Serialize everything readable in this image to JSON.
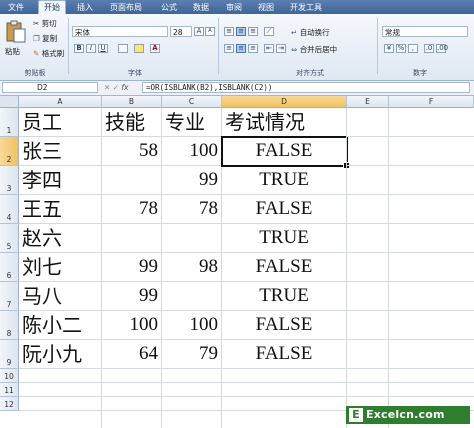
{
  "ribbon": {
    "tabs": [
      "文件",
      "开始",
      "插入",
      "页面布局",
      "公式",
      "数据",
      "审阅",
      "视图",
      "开发工具"
    ],
    "active_tab": "开始",
    "clipboard": {
      "paste": "粘贴",
      "cut": "剪切",
      "copy": "复制",
      "format_painter": "格式刷",
      "group": "剪贴板"
    },
    "font": {
      "name": "宋体",
      "size": "28",
      "bold": "B",
      "italic": "I",
      "underline": "U",
      "grow": "A",
      "shrink": "A",
      "color": "A",
      "group": "字体"
    },
    "alignment": {
      "wrap": "自动换行",
      "merge": "合并后居中",
      "group": "对齐方式"
    },
    "number": {
      "format": "常规",
      "group": "数字"
    }
  },
  "formula_bar": {
    "name_box": "D2",
    "fx": "fx",
    "formula": "=OR(ISBLANK(B2),ISBLANK(C2))"
  },
  "sheet": {
    "columns": [
      "A",
      "B",
      "C",
      "D",
      "E",
      "F"
    ],
    "rows": [
      "1",
      "2",
      "3",
      "4",
      "5",
      "6",
      "7",
      "8",
      "9",
      "10",
      "11",
      "12"
    ],
    "cells": [
      [
        "员工",
        "技能",
        "专业",
        "考试情况"
      ],
      [
        "张三",
        "58",
        "100",
        "FALSE"
      ],
      [
        "李四",
        "",
        "99",
        "TRUE"
      ],
      [
        "王五",
        "78",
        "78",
        "FALSE"
      ],
      [
        "赵六",
        "",
        "",
        "TRUE"
      ],
      [
        "刘七",
        "99",
        "98",
        "FALSE"
      ],
      [
        "马八",
        "99",
        "",
        "TRUE"
      ],
      [
        "陈小二",
        "100",
        "100",
        "FALSE"
      ],
      [
        "阮小九",
        "64",
        "79",
        "FALSE"
      ]
    ],
    "selected_cell": "D2"
  },
  "watermark": {
    "logo": "E",
    "text": "Excelcn.com"
  }
}
